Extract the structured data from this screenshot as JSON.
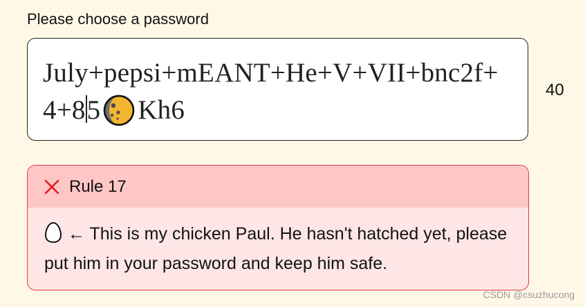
{
  "prompt": {
    "label": "Please choose a password"
  },
  "password": {
    "line1": "July+pepsi+mEANT+He+V+VII+bnc2f+",
    "line2_before_caret": "4+8",
    "line2_after_caret": "5",
    "line2_end": "Kh6",
    "moon_icon": "moon-phase-icon"
  },
  "char_count": "40",
  "rule": {
    "title": "Rule 17",
    "status_icon": "x-icon",
    "egg_icon": "egg-icon",
    "text": "← This is my chicken Paul. He hasn't hatched yet, please put him in your password and keep him safe.",
    "colors": {
      "header_bg": "#ffc6c6",
      "body_bg": "#ffe6e6",
      "border": "#e23a3a",
      "x": "#e31b1b"
    }
  },
  "watermark": "CSDN @csuzhucong"
}
